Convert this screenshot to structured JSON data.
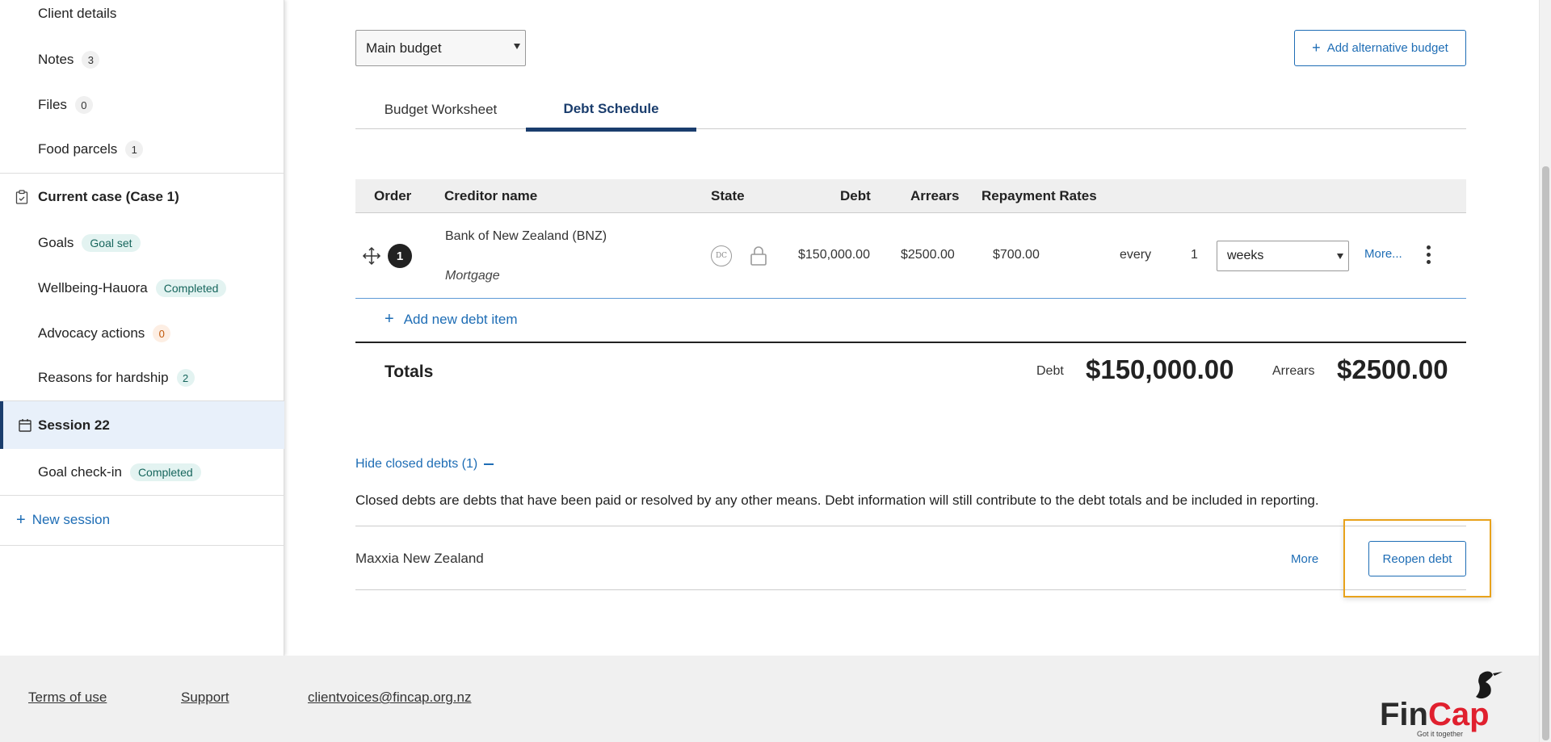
{
  "sidebar": {
    "items": [
      {
        "label": "Client details"
      },
      {
        "label": "Notes",
        "count": "3"
      },
      {
        "label": "Files",
        "count": "0"
      },
      {
        "label": "Food parcels",
        "count": "1"
      }
    ],
    "current_case": {
      "label": "Current case (Case 1)",
      "icon": "clipboard-icon"
    },
    "case_items": [
      {
        "label": "Goals",
        "badge": "Goal set"
      },
      {
        "label": "Wellbeing-Hauora",
        "badge": "Completed"
      },
      {
        "label": "Advocacy actions",
        "count": "0"
      },
      {
        "label": "Reasons for hardship",
        "count": "2"
      }
    ],
    "session": {
      "label": "Session 22",
      "icon": "calendar-icon"
    },
    "session_items": [
      {
        "label": "Goal check-in",
        "badge": "Completed"
      }
    ],
    "new_session": "New session"
  },
  "toolbar": {
    "budget_select": "Main budget",
    "add_alt_budget": "Add alternative budget"
  },
  "tabs": [
    {
      "label": "Budget Worksheet",
      "active": false
    },
    {
      "label": "Debt Schedule",
      "active": true
    }
  ],
  "table": {
    "headers": [
      "Order",
      "Creditor name",
      "State",
      "Debt",
      "Arrears",
      "Repayment Rates"
    ],
    "rows": [
      {
        "order": "1",
        "creditor": "Bank of New Zealand (BNZ)",
        "type": "Mortgage",
        "state_badge": "DC",
        "debt": "$150,000.00",
        "arrears": "$2500.00",
        "repayment": "$700.00",
        "every": "every",
        "frequency_count": "1",
        "frequency": "weeks",
        "more": "More..."
      }
    ],
    "add_item": "Add new debt item"
  },
  "totals": {
    "label": "Totals",
    "debt_label": "Debt",
    "debt_value": "$150,000.00",
    "arrears_label": "Arrears",
    "arrears_value": "$2500.00"
  },
  "closed": {
    "toggle": "Hide closed debts (1)",
    "description": "Closed debts are debts that have been paid or resolved by any other means. Debt information will still contribute to the debt totals and be included in reporting.",
    "items": [
      {
        "name": "Maxxia New Zealand",
        "more": "More",
        "reopen": "Reopen debt"
      }
    ]
  },
  "footer": {
    "terms": "Terms of use",
    "support": "Support",
    "email": "clientvoices@fincap.org.nz",
    "logo_text": "FinCap",
    "logo_tagline": "Got it together"
  },
  "colors": {
    "accent": "#1e6db5",
    "navy": "#1a3d6d",
    "brand_red": "#e0202e",
    "highlight": "#e8a21b"
  }
}
